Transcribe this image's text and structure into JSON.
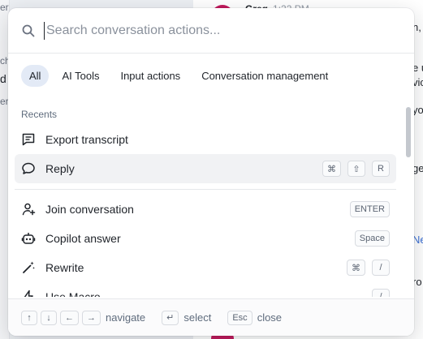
{
  "background": {
    "left_fragments": [
      "eral",
      "ch",
      "d",
      "er"
    ],
    "author": "Greg",
    "time": "1:22 PM",
    "right_fragments": [
      "n,",
      "e u",
      "vic",
      "yo",
      "ge",
      "Ne",
      "ro"
    ]
  },
  "search": {
    "placeholder": "Search conversation actions..."
  },
  "tabs": [
    {
      "label": "All",
      "active": true
    },
    {
      "label": "AI Tools",
      "active": false
    },
    {
      "label": "Input actions",
      "active": false
    },
    {
      "label": "Conversation management",
      "active": false
    }
  ],
  "recents": {
    "title": "Recents",
    "items": [
      {
        "label": "Export transcript",
        "icon": "message-lines-icon",
        "keys": []
      },
      {
        "label": "Reply",
        "icon": "chat-bubble-icon",
        "keys": [
          "⌘",
          "⇧",
          "R"
        ],
        "highlighted": true
      }
    ]
  },
  "actions": [
    {
      "label": "Join conversation",
      "icon": "user-plus-icon",
      "keys": [
        "ENTER"
      ]
    },
    {
      "label": "Copilot answer",
      "icon": "robot-icon",
      "keys": [
        "Space"
      ]
    },
    {
      "label": "Rewrite",
      "icon": "magic-wand-icon",
      "keys": [
        "⌘",
        "/"
      ]
    },
    {
      "label": "Use Macro",
      "icon": "bolt-icon",
      "keys": [
        "/"
      ]
    }
  ],
  "footer": {
    "navigate_keys": [
      "↑",
      "↓",
      "←",
      "→"
    ],
    "navigate_label": "navigate",
    "select_key": "↵",
    "select_label": "select",
    "close_key": "Esc",
    "close_label": "close"
  },
  "colors": {
    "active_tab_bg": "#e3eaf6",
    "highlight_bg": "#f1f2f4",
    "avatar_1": "#c2185b",
    "avatar_2": "#c2185b"
  }
}
